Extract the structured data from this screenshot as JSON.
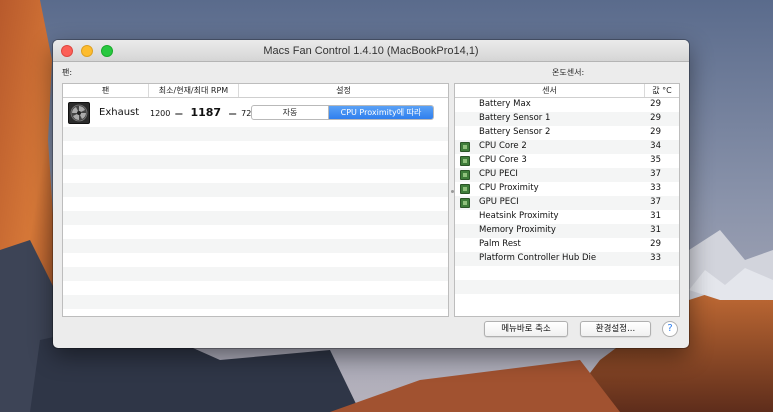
{
  "window": {
    "title": "Macs Fan Control 1.4.10 (MacBookPro14,1)"
  },
  "fans_section": {
    "label": "팬:",
    "columns": {
      "fan": "팬",
      "rpm": "최소/현재/최대 RPM",
      "settings": "설정"
    },
    "rows": [
      {
        "name": "Exhaust",
        "min_rpm": "1200",
        "current_rpm": "1187",
        "max_rpm": "72",
        "mode_auto": "자동",
        "mode_custom": "CPU Proximity에 따라",
        "selected_mode": "custom",
        "icon": "fan-icon"
      }
    ]
  },
  "sensors_section": {
    "label": "온도센서:",
    "columns": {
      "sensor": "센서",
      "value": "값 °C"
    },
    "rows": [
      {
        "name": "Battery Max",
        "value": "29",
        "icon": ""
      },
      {
        "name": "Battery Sensor 1",
        "value": "29",
        "icon": ""
      },
      {
        "name": "Battery Sensor 2",
        "value": "29",
        "icon": ""
      },
      {
        "name": "CPU Core 2",
        "value": "34",
        "icon": "chip-icon"
      },
      {
        "name": "CPU Core 3",
        "value": "35",
        "icon": "chip-icon"
      },
      {
        "name": "CPU PECI",
        "value": "37",
        "icon": "chip-icon"
      },
      {
        "name": "CPU Proximity",
        "value": "33",
        "icon": "chip-icon"
      },
      {
        "name": "GPU PECI",
        "value": "37",
        "icon": "chip-icon"
      },
      {
        "name": "Heatsink Proximity",
        "value": "31",
        "icon": ""
      },
      {
        "name": "Memory Proximity",
        "value": "31",
        "icon": ""
      },
      {
        "name": "Palm Rest",
        "value": "29",
        "icon": ""
      },
      {
        "name": "Platform Controller Hub Die",
        "value": "33",
        "icon": ""
      }
    ]
  },
  "footer": {
    "minimize_label": "메뉴바로 축소",
    "preferences_label": "환경설정...",
    "help_label": "?"
  },
  "colors": {
    "accent": "#2f7fee",
    "close": "#fc5f57",
    "minimize": "#fdbc2e",
    "zoom": "#28c840"
  }
}
